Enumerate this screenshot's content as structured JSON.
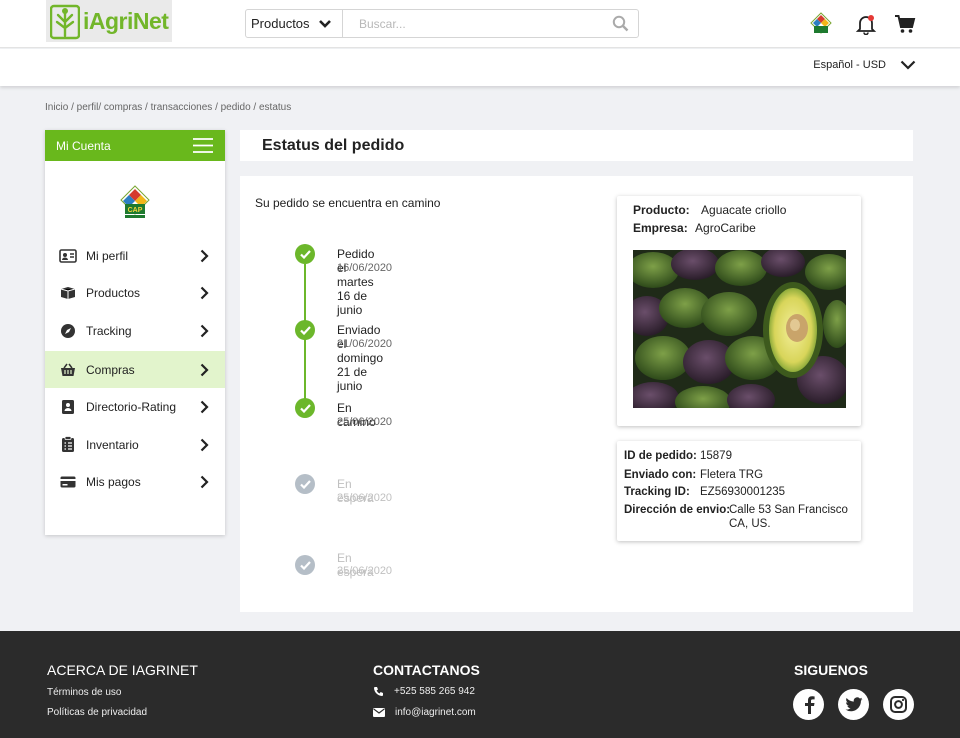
{
  "header": {
    "logo_text": "iAgriNet",
    "search_category": "Productos",
    "search_placeholder": "Buscar...",
    "language": "Español - USD"
  },
  "breadcrumb": "Inicio / perfil/ compras / transacciones / pedido / estatus",
  "sidebar": {
    "title": "Mi Cuenta",
    "items": [
      {
        "label": "Mi perfil",
        "icon": "id-card-icon"
      },
      {
        "label": "Productos",
        "icon": "boxes-icon"
      },
      {
        "label": "Tracking",
        "icon": "compass-icon"
      },
      {
        "label": "Compras",
        "icon": "basket-icon",
        "active": true
      },
      {
        "label": "Directorio-Rating",
        "icon": "contact-book-icon"
      },
      {
        "label": "Inventario",
        "icon": "clipboard-icon"
      },
      {
        "label": "Mis pagos",
        "icon": "credit-card-icon"
      }
    ]
  },
  "page_title": "Estatus del pedido",
  "status_text": "Su pedido se encuentra en camino",
  "timeline": [
    {
      "title": "Pedido el martes 16 de junio",
      "date": "16/06/2020",
      "done": true
    },
    {
      "title": "Enviado el domingo 21 de junio",
      "date": "21/06/2020",
      "done": true
    },
    {
      "title": "En camino",
      "date": "25/06/2020",
      "done": true
    },
    {
      "title": "En espera",
      "date": "25/06/2020",
      "done": false
    },
    {
      "title": "En espera",
      "date": "25/06/2020",
      "done": false
    }
  ],
  "product": {
    "product_label": "Producto:",
    "product_value": "Aguacate criollo",
    "company_label": "Empresa:",
    "company_value": "AgroCaribe"
  },
  "order": {
    "id_label": "ID de pedido:",
    "id_value": "15879",
    "sent_label": "Enviado con:",
    "sent_value": "Fletera TRG",
    "tracking_label": "Tracking  ID:",
    "tracking_value": "EZ56930001235",
    "address_label": "Dirección de envio:",
    "address_line1": "Calle 53 San Francisco",
    "address_line2": "CA, US."
  },
  "footer": {
    "about_title": "ACERCA DE IAGRINET",
    "terms": "Términos de uso",
    "privacy": "Políticas de privacidad",
    "contact_title": "CONTACTANOS",
    "phone": "+525 585 265 942",
    "email": "info@iagrinet.com",
    "follow_title": "SIGUENOS"
  },
  "colors": {
    "brand_green": "#69b81c",
    "active_bg": "#e2f4cc",
    "footer_bg": "#2b2b2b",
    "pending_gray": "#b5bec7"
  }
}
